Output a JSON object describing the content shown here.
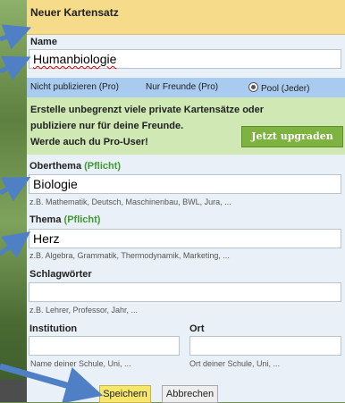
{
  "header": {
    "title": "Neuer Kartensatz"
  },
  "name": {
    "label": "Name",
    "value": "Humanbiologie"
  },
  "publish": {
    "options": [
      {
        "label": "Nicht publizieren (Pro)"
      },
      {
        "label": "Nur Freunde (Pro)"
      },
      {
        "label": "Pool (Jeder)",
        "selected": true
      }
    ]
  },
  "promo": {
    "line1": "Erstelle unbegrenzt viele private Kartensätze oder",
    "line2": "publiziere nur für deine Freunde.",
    "line3": "Werde auch du Pro-User!",
    "upgrade_label": "Jetzt upgraden"
  },
  "oberthema": {
    "label": "Oberthema",
    "required": "(Pflicht)",
    "value": "Biologie",
    "hint": "z.B. Mathematik, Deutsch, Maschinenbau, BWL, Jura, ..."
  },
  "thema": {
    "label": "Thema",
    "required": "(Pflicht)",
    "value": "Herz",
    "hint": "z.B. Algebra, Grammatik, Thermodynamik, Marketing, ..."
  },
  "schlagwoerter": {
    "label": "Schlagwörter",
    "value": "",
    "hint": "z.B. Lehrer, Professor, Jahr, ..."
  },
  "institution": {
    "label": "Institution",
    "value": "",
    "hint": "Name deiner Schule, Uni, ..."
  },
  "ort": {
    "label": "Ort",
    "value": "",
    "hint": "Ort deiner Schule, Uni, ..."
  },
  "actions": {
    "save_label": "Speichern",
    "cancel_label": "Abbrechen"
  },
  "colors": {
    "header_bg": "#f6dc8a",
    "publish_bar_bg": "#a9cbef",
    "promo_bg": "#cfe8b4",
    "upgrade_bg": "#7fb341",
    "save_bg": "#f6e66b",
    "required_text": "#3f9a2f",
    "arrow": "#4f7fc4"
  }
}
